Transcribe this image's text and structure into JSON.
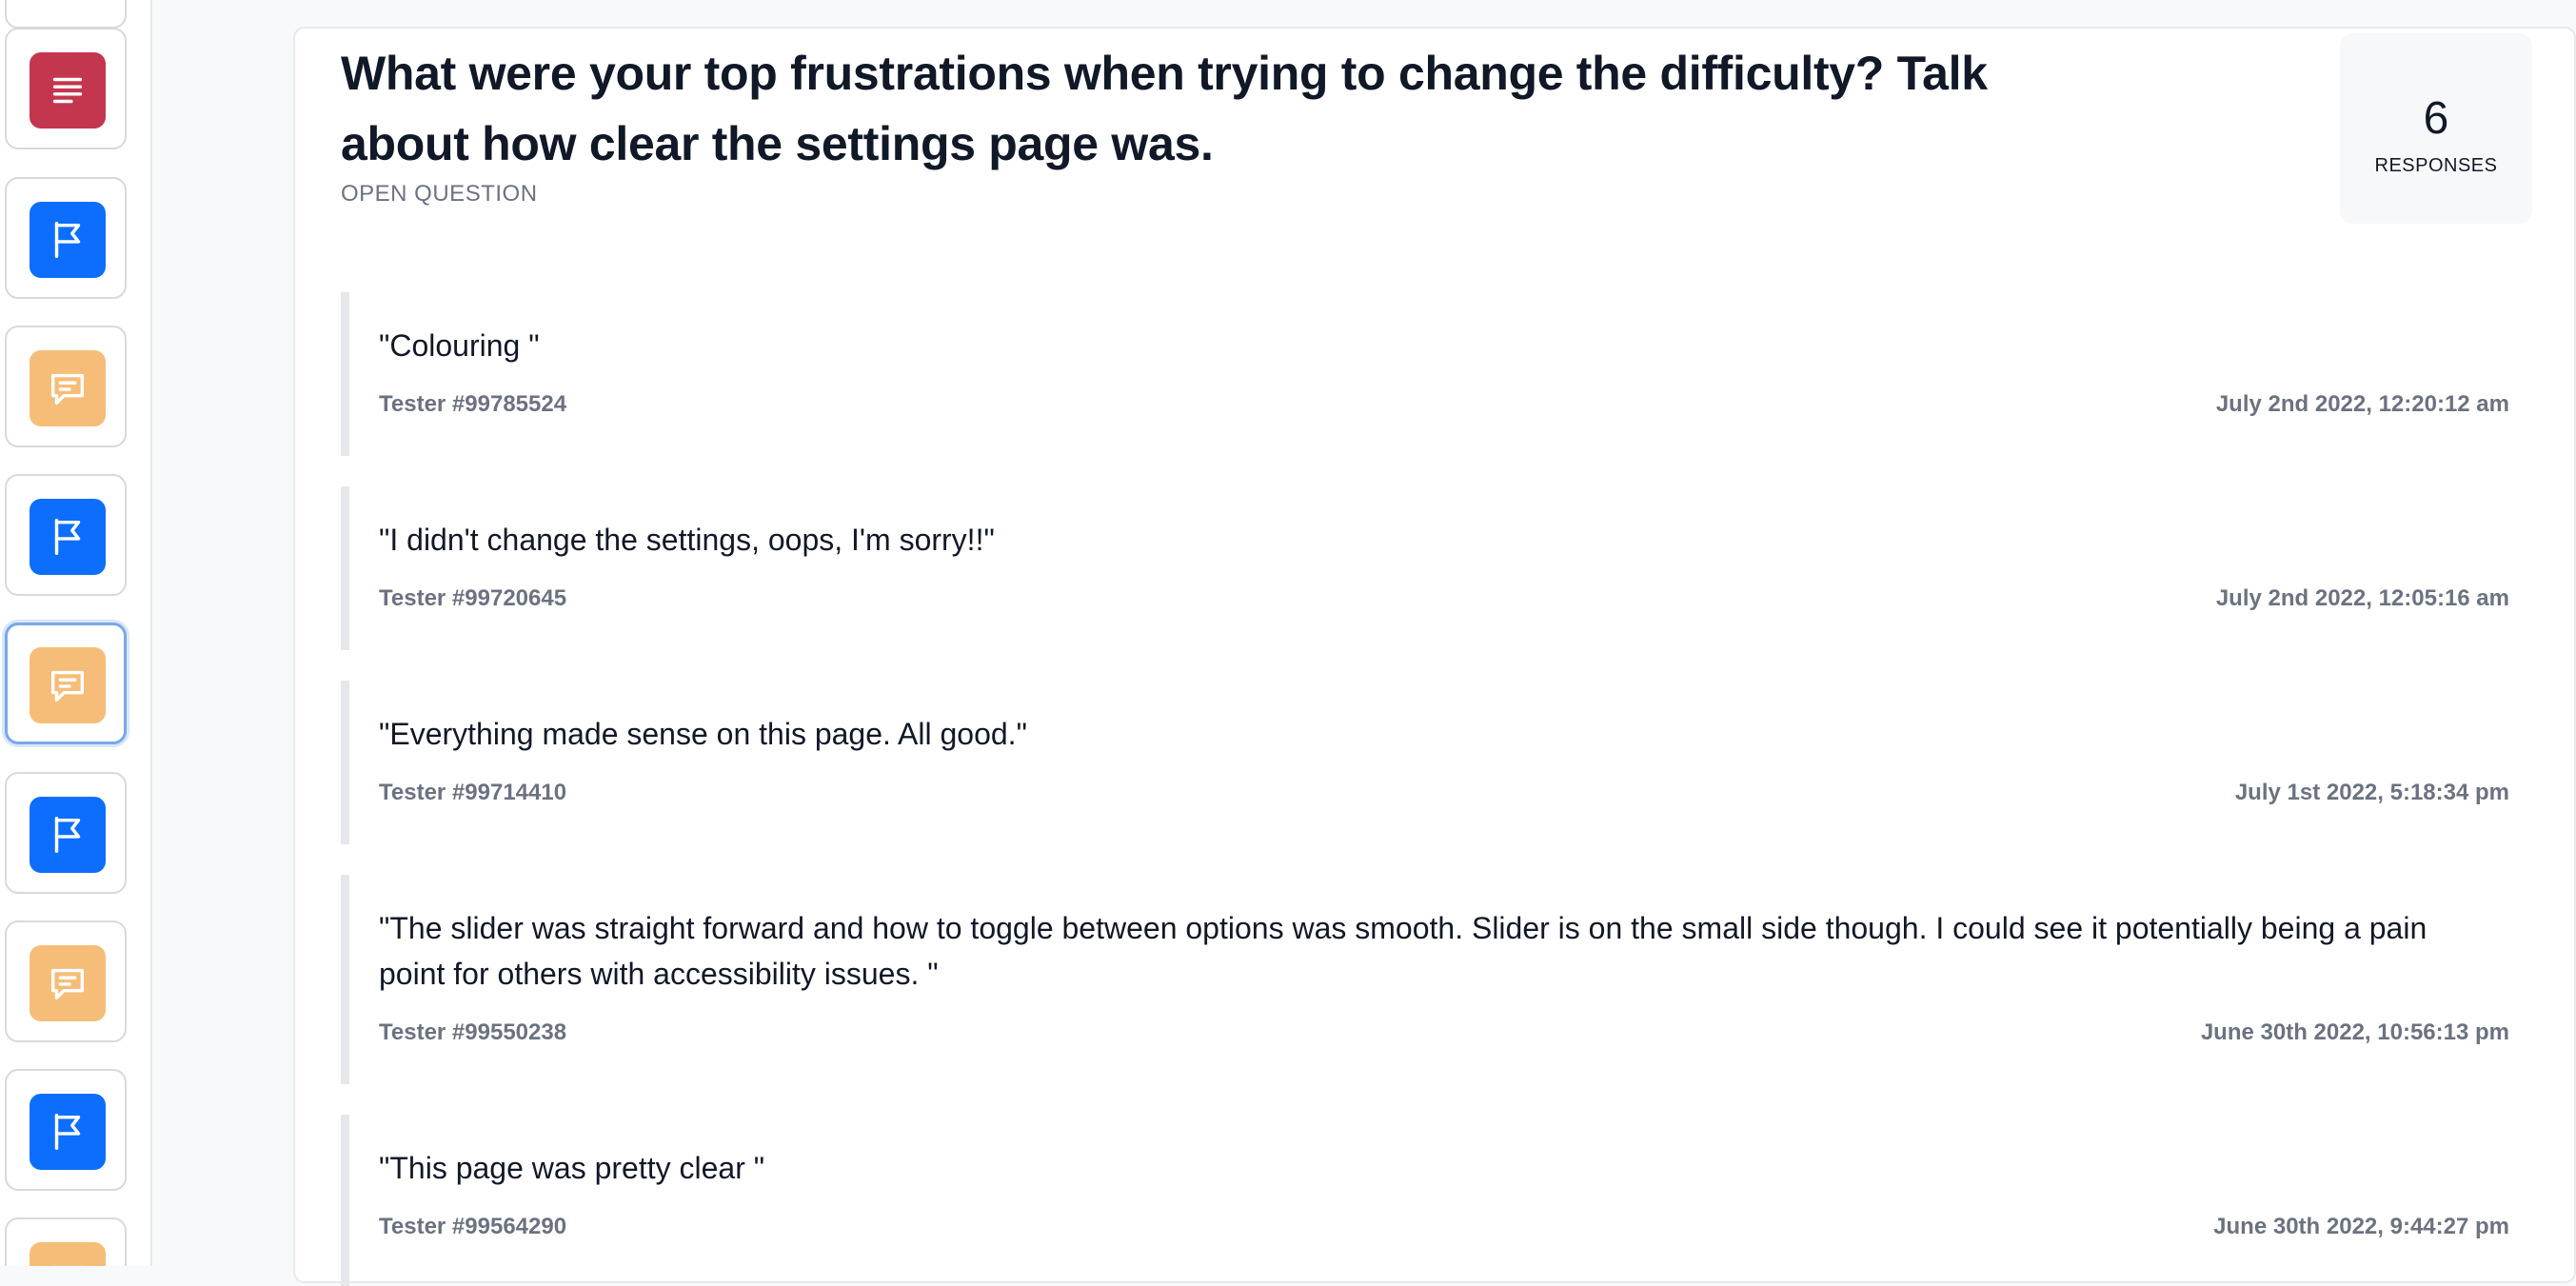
{
  "sidebar": {
    "items": [
      {
        "icon": "text-document-icon",
        "color": "#c4364d"
      },
      {
        "icon": "flag-icon",
        "color": "#0d6efd"
      },
      {
        "icon": "chat-bubble-icon",
        "color": "#f6bd78"
      },
      {
        "icon": "flag-icon",
        "color": "#0d6efd"
      },
      {
        "icon": "chat-bubble-icon",
        "color": "#f6bd78",
        "active": true
      },
      {
        "icon": "flag-icon",
        "color": "#0d6efd"
      },
      {
        "icon": "chat-bubble-icon",
        "color": "#f6bd78"
      },
      {
        "icon": "flag-icon",
        "color": "#0d6efd"
      },
      {
        "icon": "chat-bubble-icon",
        "color": "#f6bd78"
      }
    ]
  },
  "question": {
    "title": "What were your top frustrations when trying to change the difficulty? Talk about how clear the settings page was.",
    "type": "OPEN QUESTION"
  },
  "responses_count": {
    "value": "6",
    "label": "RESPONSES"
  },
  "responses": [
    {
      "text": "\"Colouring \"",
      "tester": "Tester #99785524",
      "date": "July 2nd 2022, 12:20:12 am"
    },
    {
      "text": "\"I didn't change the settings, oops, I'm sorry!!\"",
      "tester": "Tester #99720645",
      "date": "July 2nd 2022, 12:05:16 am"
    },
    {
      "text": "\"Everything made sense on this page. All good.\"",
      "tester": "Tester #99714410",
      "date": "July 1st 2022, 5:18:34 pm"
    },
    {
      "text": "\"The slider was straight forward and how to toggle between options was smooth. Slider is on the small side though. I could see it potentially being a pain point for others with accessibility issues. \"",
      "tester": "Tester #99550238",
      "date": "June 30th 2022, 10:56:13 pm"
    },
    {
      "text": "\"This page was pretty clear \"",
      "tester": "Tester #99564290",
      "date": "June 30th 2022, 9:44:27 pm"
    }
  ]
}
